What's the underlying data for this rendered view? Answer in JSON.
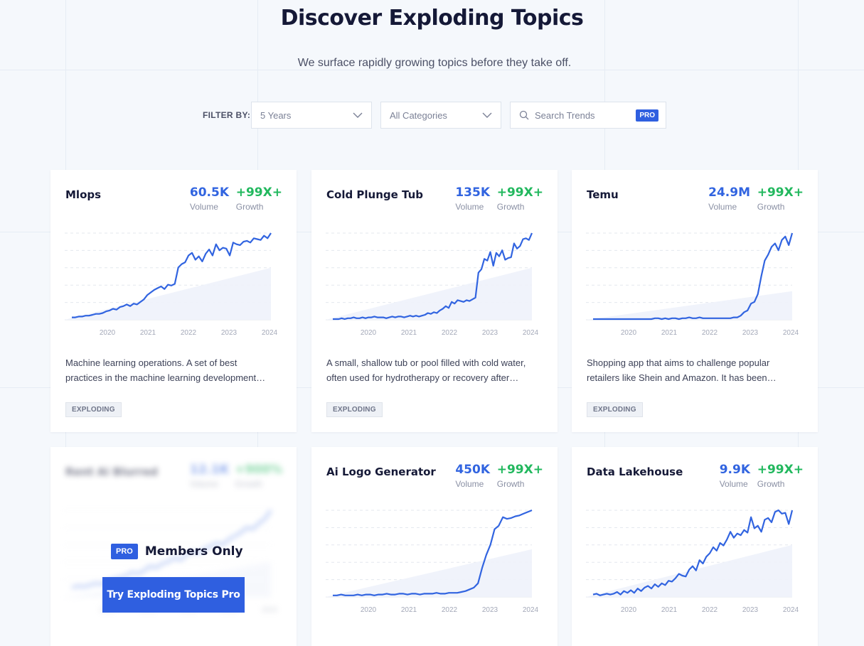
{
  "header": {
    "title": "Discover Exploding Topics",
    "subtitle": "We surface rapidly growing topics before they take off."
  },
  "filters": {
    "label": "FILTER BY:",
    "timeframe": "5 Years",
    "category": "All Categories",
    "search_placeholder": "Search Trends",
    "search_badge": "PRO"
  },
  "stat_labels": {
    "volume": "Volume",
    "growth": "Growth"
  },
  "tag_label": "EXPLODING",
  "years": [
    "2020",
    "2021",
    "2022",
    "2023",
    "2024"
  ],
  "cards": [
    {
      "name": "Mlops",
      "volume": "60.5K",
      "growth": "+99X+",
      "description_1": "Machine learning operations. A set of best",
      "description_2": "practices in the machine learning development…",
      "trend": [
        2,
        2,
        3,
        3,
        4,
        4,
        5,
        6,
        6,
        7,
        9,
        10,
        12,
        11,
        14,
        15,
        17,
        15,
        18,
        17,
        20,
        23,
        28,
        31,
        34,
        36,
        38,
        35,
        40,
        39,
        41,
        60,
        64,
        66,
        74,
        77,
        69,
        73,
        67,
        76,
        81,
        74,
        87,
        80,
        83,
        82,
        74,
        89,
        87,
        86,
        90,
        91,
        89,
        94,
        93,
        92,
        97,
        94,
        100
      ],
      "baseline": [
        0,
        60
      ]
    },
    {
      "name": "Cold Plunge Tub",
      "volume": "135K",
      "growth": "+99X+",
      "description_1": "A small, shallow tub or pool filled with cold water,",
      "description_2": "often used for hydrotherapy or recovery after…",
      "trend": [
        0,
        0,
        0,
        1,
        0,
        1,
        1,
        2,
        1,
        1,
        2,
        1,
        2,
        2,
        3,
        2,
        2,
        2,
        1,
        2,
        3,
        2,
        3,
        3,
        2,
        3,
        4,
        3,
        4,
        3,
        4,
        5,
        7,
        6,
        8,
        7,
        10,
        12,
        15,
        13,
        20,
        18,
        22,
        21,
        20,
        22,
        21,
        23,
        25,
        54,
        58,
        70,
        68,
        78,
        62,
        77,
        73,
        80,
        69,
        71,
        72,
        88,
        82,
        85,
        93,
        94,
        92,
        100
      ],
      "baseline": [
        0,
        60
      ]
    },
    {
      "name": "Temu",
      "volume": "24.9M",
      "growth": "+99X+",
      "description_1": "Shopping app that aims to challenge popular",
      "description_2": "retailers like Shein and Amazon. It has been…",
      "trend": [
        0,
        0,
        0,
        0,
        0,
        0,
        0,
        0,
        0,
        0,
        0,
        0,
        0,
        0,
        0,
        0,
        0,
        0,
        1,
        1,
        0,
        1,
        0,
        1,
        1,
        0,
        1,
        1,
        2,
        1,
        1,
        2,
        1,
        1,
        1,
        1,
        1,
        1,
        1,
        1,
        1,
        2,
        2,
        4,
        8,
        10,
        18,
        20,
        29,
        50,
        68,
        75,
        84,
        88,
        80,
        92,
        96,
        86,
        100
      ],
      "baseline": [
        0,
        33
      ]
    },
    {
      "name": "Ai Logo Generator",
      "volume": "450K",
      "growth": "+99X+",
      "description_1": "",
      "description_2": "",
      "trend": [
        1,
        1,
        2,
        1,
        1,
        1,
        2,
        1,
        2,
        2,
        1,
        2,
        2,
        3,
        2,
        2,
        3,
        3,
        2,
        3,
        3,
        2,
        3,
        3,
        3,
        4,
        3,
        3,
        4,
        4,
        4,
        5,
        6,
        8,
        10,
        15,
        33,
        48,
        60,
        78,
        82,
        92,
        90,
        91,
        93,
        94,
        96,
        98,
        100
      ],
      "baseline": [
        0,
        55
      ]
    },
    {
      "name": "Data Lakehouse",
      "volume": "9.9K",
      "growth": "+99X+",
      "description_1": "",
      "description_2": "",
      "trend": [
        2,
        3,
        1,
        2,
        3,
        2,
        3,
        5,
        2,
        6,
        4,
        7,
        4,
        9,
        6,
        10,
        12,
        9,
        14,
        11,
        15,
        13,
        18,
        17,
        21,
        26,
        24,
        23,
        31,
        35,
        30,
        42,
        38,
        46,
        50,
        57,
        53,
        62,
        59,
        66,
        75,
        68,
        73,
        71,
        77,
        74,
        92,
        79,
        82,
        75,
        89,
        91,
        86,
        98,
        100,
        96,
        97,
        84,
        100
      ],
      "baseline": [
        0,
        60
      ]
    },
    {
      "name": "Rent Ai Blurred",
      "volume": "12.1K",
      "growth": "+900%",
      "description_1": "",
      "description_2": "",
      "trend": [
        10,
        12,
        11,
        13,
        15,
        14,
        18,
        20,
        22,
        24,
        28,
        26,
        30,
        35,
        33,
        38,
        40,
        45,
        42,
        48,
        52,
        50,
        55,
        58,
        62,
        60,
        66,
        70,
        74,
        80,
        78,
        85,
        90,
        100
      ],
      "baseline": [
        0,
        40
      ]
    }
  ],
  "locked": {
    "badge": "PRO",
    "text": "Members Only",
    "button": "Try Exploding Topics Pro"
  },
  "colors": {
    "accent": "#2f5fe0",
    "line": "#3164e0",
    "growth": "#22b85e"
  }
}
